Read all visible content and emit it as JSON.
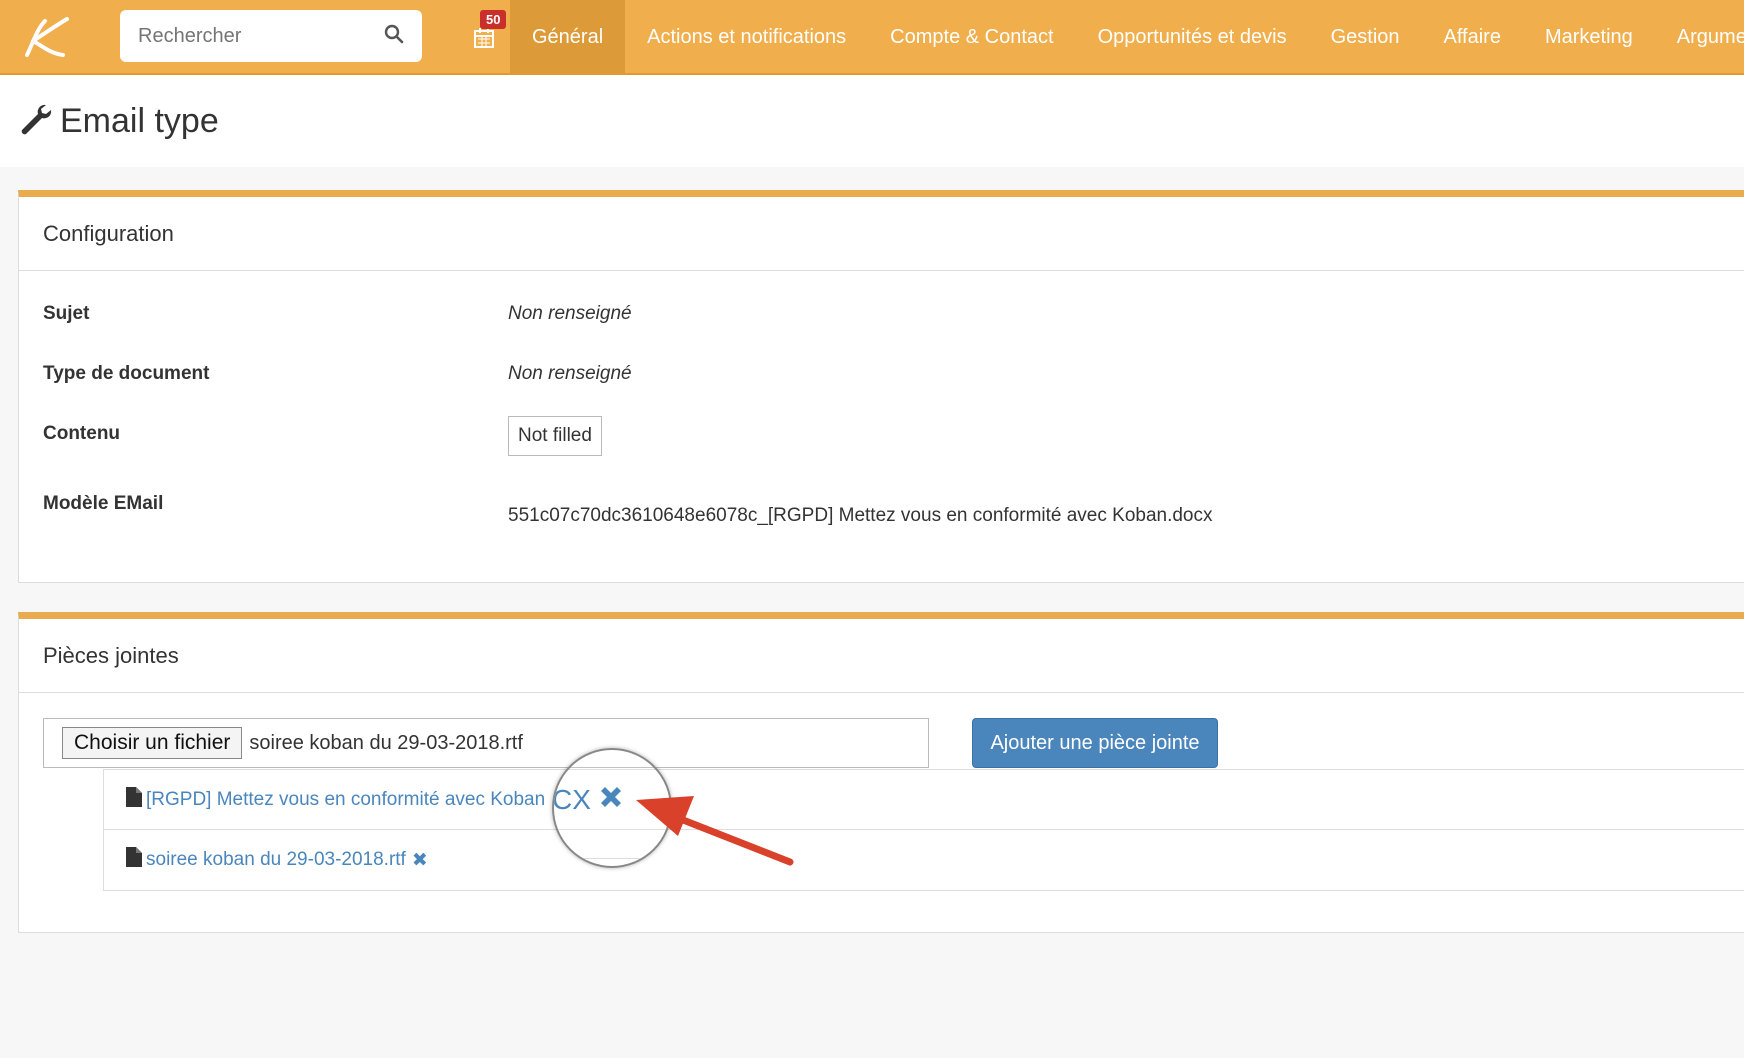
{
  "topbar": {
    "search_placeholder": "Rechercher",
    "badge": "50",
    "nav": [
      "Général",
      "Actions et notifications",
      "Compte & Contact",
      "Opportunités et devis",
      "Gestion",
      "Affaire",
      "Marketing",
      "Argume"
    ]
  },
  "page": {
    "title": "Email type"
  },
  "config": {
    "header": "Configuration",
    "rows": [
      {
        "label": "Sujet",
        "value": "Non renseigné"
      },
      {
        "label": "Type de document",
        "value": "Non renseigné"
      },
      {
        "label": "Contenu",
        "value": "Not filled"
      },
      {
        "label": "Modèle EMail",
        "value": "551c07c70dc3610648e6078c_[RGPD] Mettez vous en conformité avec Koban.docx"
      }
    ]
  },
  "attachments": {
    "header": "Pièces jointes",
    "file_button": "Choisir un fichier",
    "file_name": "soiree koban du 29-03-2018.rtf",
    "add_button": "Ajouter une pièce jointe",
    "items": [
      {
        "name": "[RGPD] Mettez vous en conformité avec Koban"
      },
      {
        "name": "soiree koban du 29-03-2018.rtf"
      }
    ],
    "magnified_text": "CX"
  },
  "colors": {
    "accent": "#f0ae4c",
    "link": "#4a86bc",
    "arrow": "#d9412a"
  }
}
